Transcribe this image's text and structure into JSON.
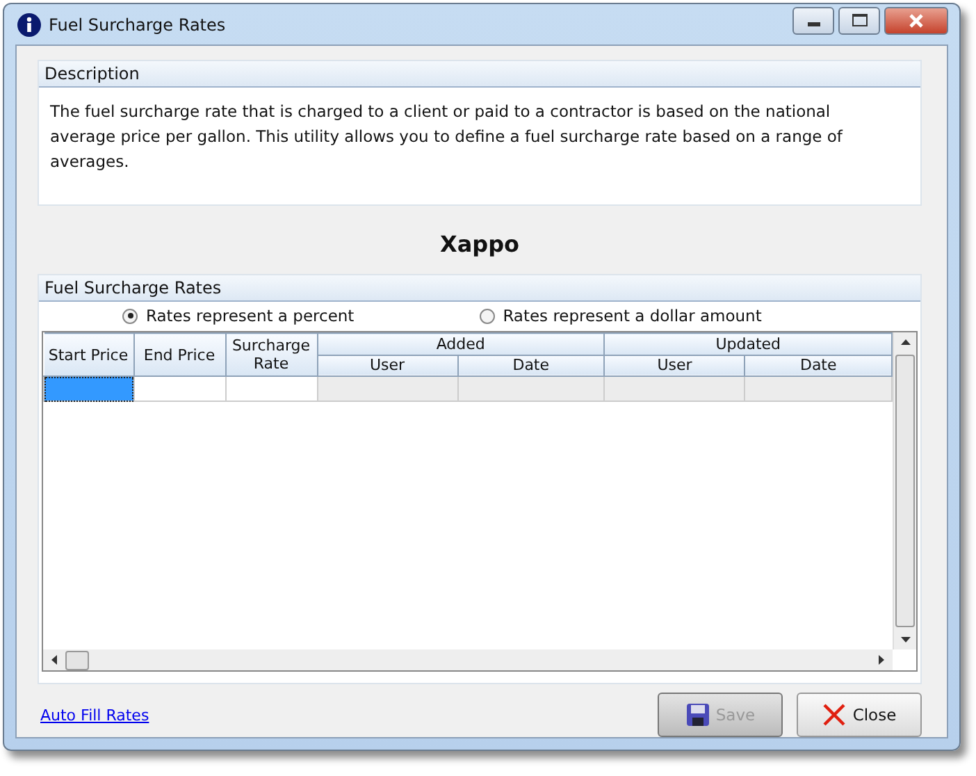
{
  "window": {
    "title": "Fuel Surcharge Rates"
  },
  "description": {
    "header": "Description",
    "text": "The fuel surcharge rate that is charged to a client or paid to a contractor is based on the national average price per gallon.  This utility allows you to define a fuel surcharge rate based on a range of averages."
  },
  "company": "Xappo",
  "rates": {
    "header": "Fuel Surcharge Rates",
    "options": [
      {
        "label": "Rates represent a percent",
        "selected": true
      },
      {
        "label": "Rates represent a dollar amount",
        "selected": false
      }
    ],
    "table": {
      "columns": [
        {
          "label": "Start Price"
        },
        {
          "label": "End Price"
        },
        {
          "label": "Surcharge Rate"
        },
        {
          "label": "Added",
          "children": [
            {
              "label": "User"
            },
            {
              "label": "Date"
            }
          ]
        },
        {
          "label": "Updated",
          "children": [
            {
              "label": "User"
            },
            {
              "label": "Date"
            }
          ]
        }
      ],
      "rows": [
        {
          "cells": [
            {
              "selected": true,
              "disabled": false
            },
            {
              "selected": false,
              "disabled": false
            },
            {
              "selected": false,
              "disabled": false
            },
            {
              "selected": false,
              "disabled": true
            },
            {
              "selected": false,
              "disabled": true
            },
            {
              "selected": false,
              "disabled": true
            },
            {
              "selected": false,
              "disabled": true
            }
          ]
        }
      ]
    }
  },
  "link": "Auto Fill Rates",
  "buttons": [
    {
      "label": "Save",
      "kind": "save",
      "disabled": true
    },
    {
      "label": "Close",
      "kind": "close",
      "disabled": false
    }
  ]
}
